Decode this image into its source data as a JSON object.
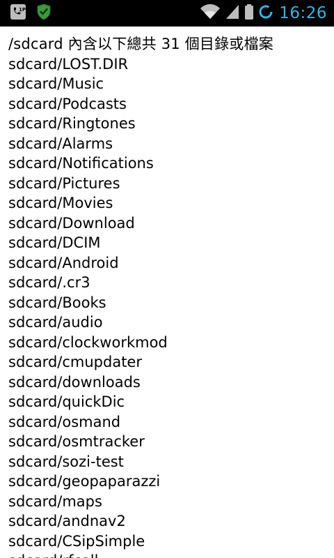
{
  "status_bar": {
    "time": "16:26",
    "icons": [
      "voicemail-icon",
      "shield-icon",
      "wifi-icon",
      "signal-icon",
      "battery-icon"
    ],
    "colors": {
      "background": "#000000",
      "clock": "#33b5e5",
      "shield": "#3a9a3a",
      "system_icons": "#bdbdbd"
    }
  },
  "content": {
    "header": "/sdcard 內含以下總共 31 個目錄或檔案",
    "entries": [
      "sdcard/LOST.DIR",
      "sdcard/Music",
      "sdcard/Podcasts",
      "sdcard/Ringtones",
      "sdcard/Alarms",
      "sdcard/Notifications",
      "sdcard/Pictures",
      "sdcard/Movies",
      "sdcard/Download",
      "sdcard/DCIM",
      "sdcard/Android",
      "sdcard/.cr3",
      "sdcard/Books",
      "sdcard/audio",
      "sdcard/clockworkmod",
      "sdcard/cmupdater",
      "sdcard/downloads",
      "sdcard/quickDic",
      "sdcard/osmand",
      "sdcard/osmtracker",
      "sdcard/sozi-test",
      "sdcard/geopaparazzi",
      "sdcard/maps",
      "sdcard/andnav2",
      "sdcard/CSipSimple",
      "sdcard/rfcall"
    ]
  }
}
